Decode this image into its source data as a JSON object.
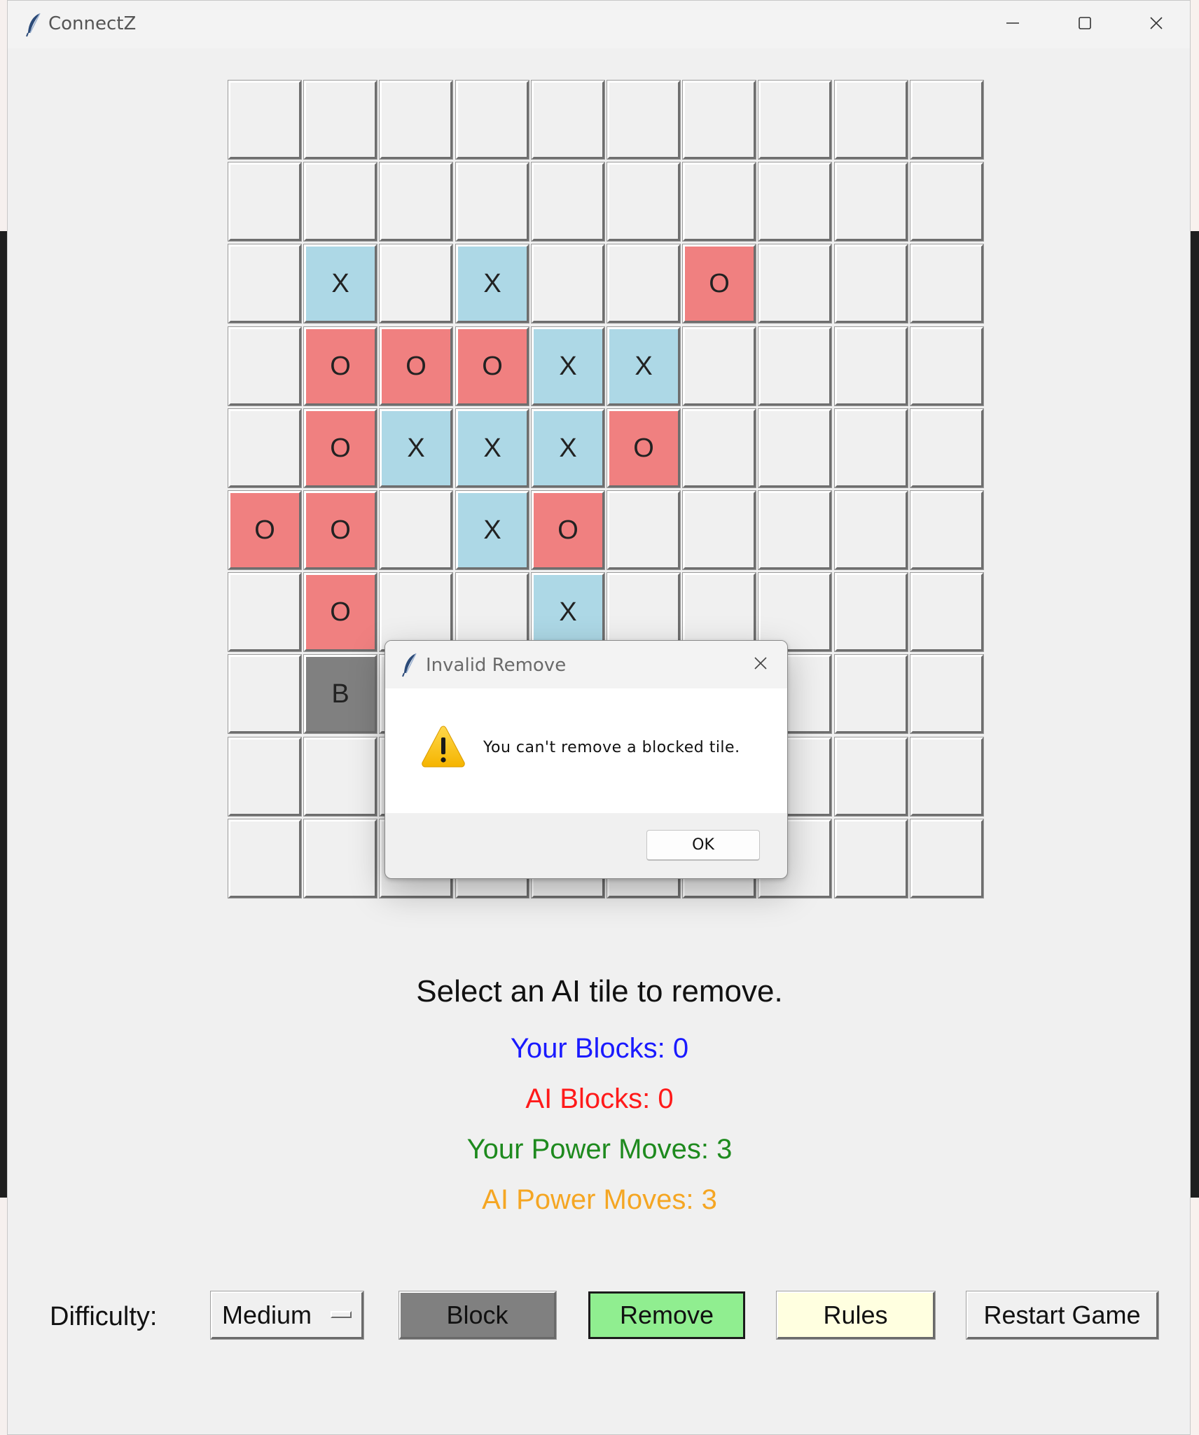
{
  "window": {
    "title": "ConnectZ"
  },
  "board": {
    "rows": [
      [
        "",
        "",
        "",
        "",
        "",
        "",
        "",
        "",
        "",
        ""
      ],
      [
        "",
        "",
        "",
        "",
        "",
        "",
        "",
        "",
        "",
        ""
      ],
      [
        "",
        "X",
        "",
        "X",
        "",
        "",
        "O",
        "",
        "",
        ""
      ],
      [
        "",
        "O",
        "O",
        "O",
        "X",
        "X",
        "",
        "",
        "",
        ""
      ],
      [
        "",
        "O",
        "X",
        "X",
        "X",
        "O",
        "",
        "",
        "",
        ""
      ],
      [
        "O",
        "O",
        "",
        "X",
        "O",
        "",
        "",
        "",
        "",
        ""
      ],
      [
        "",
        "O",
        "",
        "",
        "X",
        "",
        "",
        "",
        "",
        ""
      ],
      [
        "",
        "B",
        "",
        "",
        "",
        "",
        "",
        "",
        "",
        ""
      ],
      [
        "",
        "",
        "",
        "",
        "",
        "",
        "",
        "",
        "",
        ""
      ],
      [
        "",
        "",
        "",
        "",
        "",
        "",
        "",
        "",
        "",
        ""
      ]
    ],
    "colors": {
      "X": "#add8e6",
      "O": "#f08080",
      "B": "#808080",
      "empty": "#f0f0f0"
    }
  },
  "dialog": {
    "title": "Invalid Remove",
    "message": "You can't remove a blocked tile.",
    "ok_label": "OK",
    "icon": "warning-icon"
  },
  "status": {
    "message": "Select an AI tile to remove.",
    "your_blocks": "Your Blocks: 0",
    "ai_blocks": "AI Blocks: 0",
    "your_power_moves": "Your Power Moves: 3",
    "ai_power_moves": "AI Power Moves: 3",
    "colors": {
      "your_blocks": "#1a1aff",
      "ai_blocks": "#ff1a1a",
      "your_power_moves": "#1e8a1e",
      "ai_power_moves": "#f5a623"
    }
  },
  "controls": {
    "difficulty_label": "Difficulty:",
    "difficulty_value": "Medium",
    "block_label": "Block",
    "remove_label": "Remove",
    "rules_label": "Rules",
    "restart_label": "Restart Game",
    "colors": {
      "block": "#808080",
      "remove": "#90ee90",
      "rules": "#ffffe0"
    }
  }
}
